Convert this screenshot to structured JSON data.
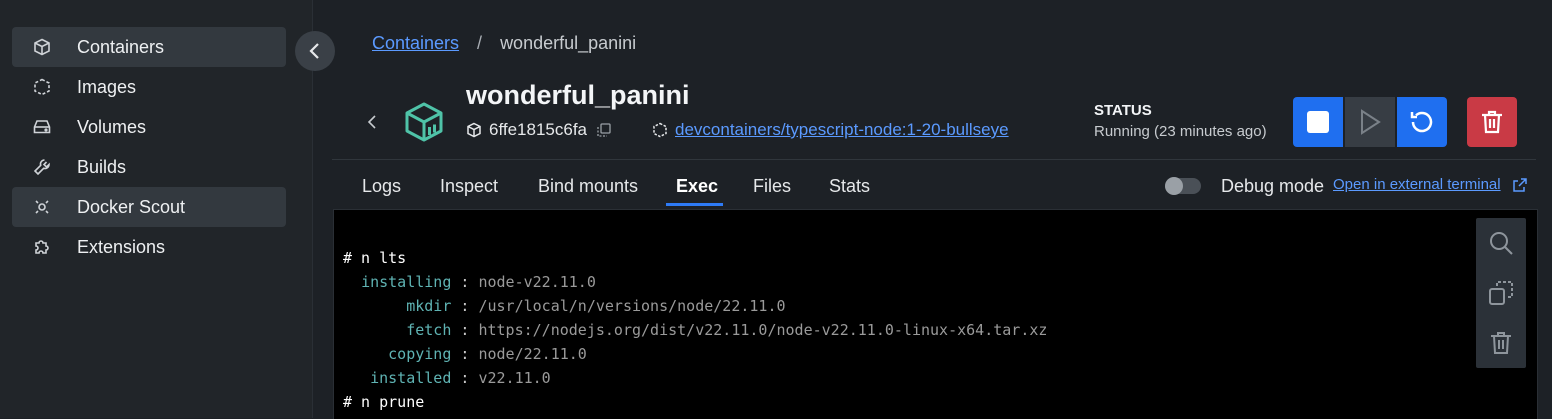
{
  "sidebar": {
    "items": [
      {
        "label": "Containers",
        "icon": "container-cube-icon"
      },
      {
        "label": "Images",
        "icon": "image-cloud-icon"
      },
      {
        "label": "Volumes",
        "icon": "volume-drive-icon"
      },
      {
        "label": "Builds",
        "icon": "wrench-icon"
      },
      {
        "label": "Docker Scout",
        "icon": "scout-icon"
      },
      {
        "label": "Extensions",
        "icon": "puzzle-icon"
      }
    ]
  },
  "breadcrumb": {
    "parent": "Containers",
    "separator": "/",
    "current": "wonderful_panini"
  },
  "container": {
    "name": "wonderful_panini",
    "id": "6ffe1815c6fa",
    "image": "devcontainers/typescript-node:1-20-bullseye"
  },
  "status": {
    "heading": "STATUS",
    "value": "Running (23 minutes ago)"
  },
  "tabs": [
    {
      "label": "Logs"
    },
    {
      "label": "Inspect"
    },
    {
      "label": "Bind mounts"
    },
    {
      "label": "Exec"
    },
    {
      "label": "Files"
    },
    {
      "label": "Stats"
    }
  ],
  "active_tab": "Exec",
  "debug": {
    "label": "Debug mode",
    "enabled": false
  },
  "external_terminal": {
    "label": "Open in external terminal"
  },
  "terminal": {
    "lines": [
      {
        "cmd": "# n lts"
      },
      {
        "pad": "  ",
        "key": "installing",
        "sep": " : ",
        "val": "node-v22.11.0"
      },
      {
        "pad": "       ",
        "key": "mkdir",
        "sep": " : ",
        "val": "/usr/local/n/versions/node/22.11.0"
      },
      {
        "pad": "       ",
        "key": "fetch",
        "sep": " : ",
        "val": "https://nodejs.org/dist/v22.11.0/node-v22.11.0-linux-x64.tar.xz"
      },
      {
        "pad": "     ",
        "key": "copying",
        "sep": " : ",
        "val": "node/22.11.0"
      },
      {
        "pad": "   ",
        "key": "installed",
        "sep": " : ",
        "val": "v22.11.0"
      },
      {
        "cmd": "# n prune"
      }
    ]
  },
  "colors": {
    "accent": "#1f6ff0",
    "danger": "#c93a45",
    "link": "#5b9aff",
    "terminal_key": "#5fb3b3"
  }
}
